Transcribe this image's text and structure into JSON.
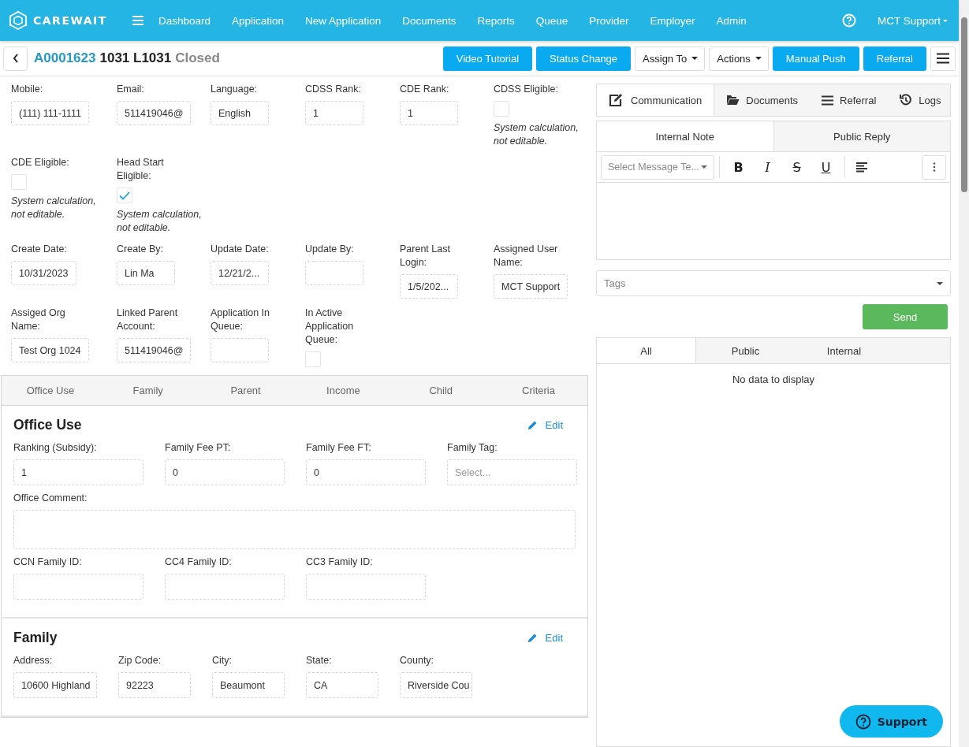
{
  "nav": {
    "brand": "CAREWAIT",
    "menu": [
      "Dashboard",
      "Application",
      "New Application",
      "Documents",
      "Reports",
      "Queue",
      "Provider",
      "Employer",
      "Admin"
    ],
    "user": "MCT Support"
  },
  "header": {
    "app_id": "A0001623",
    "name": "1031 L1031",
    "status": "Closed",
    "actions": [
      {
        "label": "Video Tutorial",
        "kind": "primary"
      },
      {
        "label": "Status Change",
        "kind": "primary"
      },
      {
        "label": "Assign To",
        "kind": "dropdown"
      },
      {
        "label": "Actions",
        "kind": "dropdown"
      },
      {
        "label": "Manual Push",
        "kind": "primary"
      },
      {
        "label": "Referral",
        "kind": "primary"
      }
    ]
  },
  "summary_rows": [
    [
      {
        "label": "Mobile:",
        "kind": "input",
        "value": "(111) 111-1111"
      },
      {
        "label": "Email:",
        "kind": "input",
        "value": "511419046@"
      },
      {
        "label": "Language:",
        "kind": "input",
        "value": "English"
      },
      {
        "label": "CDSS Rank:",
        "kind": "input",
        "value": "1"
      },
      {
        "label": "CDE Rank:",
        "kind": "input",
        "value": "1"
      },
      {
        "label": "CDSS Eligible:",
        "kind": "checkbox",
        "checked": false,
        "note": "System calculation, not editable."
      }
    ],
    [
      {
        "label": "CDE Eligible:",
        "kind": "checkbox",
        "checked": false,
        "note": "System calculation, not editable."
      },
      {
        "label": "Head Start Eligible:",
        "kind": "checkbox",
        "checked": true,
        "note": "System calculation, not editable."
      }
    ],
    [
      {
        "label": "Create Date:",
        "kind": "input",
        "value": "10/31/2023"
      },
      {
        "label": "Create By:",
        "kind": "input",
        "value": "Lin Ma"
      },
      {
        "label": "Update Date:",
        "kind": "input",
        "value": "12/21/2..."
      },
      {
        "label": "Update By:",
        "kind": "input"
      },
      {
        "label": "Parent Last Login:",
        "kind": "input",
        "value": "1/5/202..."
      },
      {
        "label": "Assigned User Name:",
        "kind": "input",
        "value": "MCT Support"
      }
    ],
    [
      {
        "label": "Assiged Org Name:",
        "kind": "input",
        "value": "Test Org 1024"
      },
      {
        "label": "Linked Parent Account:",
        "kind": "input",
        "value": "511419046@"
      },
      {
        "label": "Application In Queue:",
        "kind": "input"
      },
      {
        "label": "In Active Application Queue:",
        "kind": "checkbox",
        "checked": false
      }
    ]
  ],
  "section_tabs": [
    "Office Use",
    "Family",
    "Parent",
    "Income",
    "Child",
    "Criteria"
  ],
  "sections": [
    {
      "title": "Office Use",
      "action": "Edit",
      "rows": [
        {
          "kind": "four",
          "fields": [
            {
              "label": "Ranking (Subsidy):",
              "kind": "input",
              "value": "1"
            },
            {
              "label": "Family Fee PT:",
              "kind": "input",
              "value": "0"
            },
            {
              "label": "Family Fee FT:",
              "kind": "input",
              "value": "0"
            },
            {
              "label": "Family Tag:",
              "kind": "select",
              "placeholder": "Select..."
            }
          ]
        },
        {
          "kind": "full",
          "fields": [
            {
              "label": "Office Comment:",
              "kind": "textarea"
            }
          ]
        },
        {
          "kind": "four",
          "fields": [
            {
              "label": "CCN Family ID:",
              "kind": "input"
            },
            {
              "label": "CC4 Family ID:",
              "kind": "input"
            },
            {
              "label": "CC3 Family ID:",
              "kind": "input"
            }
          ]
        }
      ]
    },
    {
      "title": "Family",
      "action": "Edit",
      "rows": [
        {
          "kind": "five",
          "fields": [
            {
              "label": "Address:",
              "kind": "input",
              "value": "10600 Highland"
            },
            {
              "label": "Zip Code:",
              "kind": "input",
              "value": "92223"
            },
            {
              "label": "City:",
              "kind": "input",
              "value": "Beaumont"
            },
            {
              "label": "State:",
              "kind": "input",
              "value": "CA"
            },
            {
              "label": "County:",
              "kind": "input",
              "value": "Riverside Cou"
            }
          ]
        }
      ]
    }
  ],
  "panel_tabs": [
    {
      "label": "Communication",
      "selected": true
    },
    {
      "label": "Documents",
      "selected": false
    },
    {
      "label": "Referral",
      "selected": false
    },
    {
      "label": "Logs",
      "selected": false
    }
  ],
  "compose_tabs": [
    {
      "label": "Internal Note",
      "selected": true
    },
    {
      "label": "Public Reply",
      "selected": false
    }
  ],
  "editor": {
    "template_placeholder": "Select Message Te...",
    "tools": [
      {
        "kind": "bold",
        "label": "B"
      },
      {
        "kind": "italic",
        "label": "I"
      },
      {
        "kind": "strike",
        "label": "S"
      },
      {
        "kind": "underline",
        "label": "U"
      }
    ]
  },
  "tags_placeholder": "Tags",
  "send": "Send",
  "filter_tabs": [
    {
      "label": "All",
      "selected": true
    },
    {
      "label": "Public",
      "selected": false
    },
    {
      "label": "Internal",
      "selected": false
    }
  ],
  "empty_message": "No data to display",
  "support": "Support"
}
